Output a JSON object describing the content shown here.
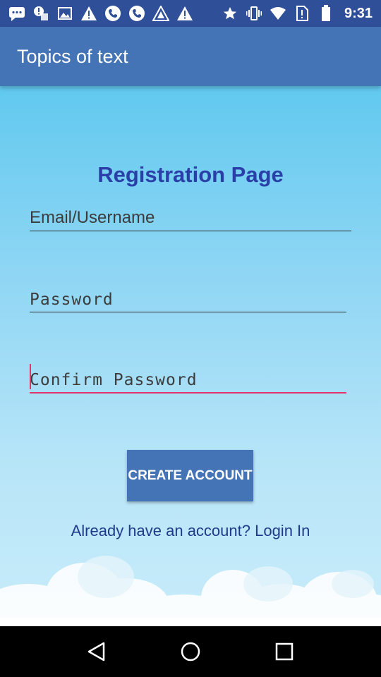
{
  "status_bar": {
    "time": "9:31",
    "left_icons": [
      "message-icon",
      "alert-notification-icon",
      "image-icon",
      "warning-icon",
      "phone-icon",
      "phone-icon",
      "app-icon",
      "warning-icon"
    ],
    "right_icons": [
      "star-icon",
      "vibrate-icon",
      "wifi-icon",
      "no-sim-icon",
      "battery-icon"
    ]
  },
  "app_bar": {
    "title": "Topics of text"
  },
  "form": {
    "title": "Registration Page",
    "email_placeholder": "Email/Username",
    "password_placeholder": "Password",
    "confirm_placeholder": "Confirm Password",
    "create_button": "CREATE ACCOUNT",
    "login_link": "Already have an account? Login In"
  },
  "colors": {
    "status_bar": "#2f4f99",
    "app_bar": "#4474b5",
    "title": "#2a40a8",
    "focus_accent": "#e0366a",
    "button": "#4474b5"
  },
  "nav_bar": {
    "buttons": [
      "back-icon",
      "home-icon",
      "recents-icon"
    ]
  }
}
